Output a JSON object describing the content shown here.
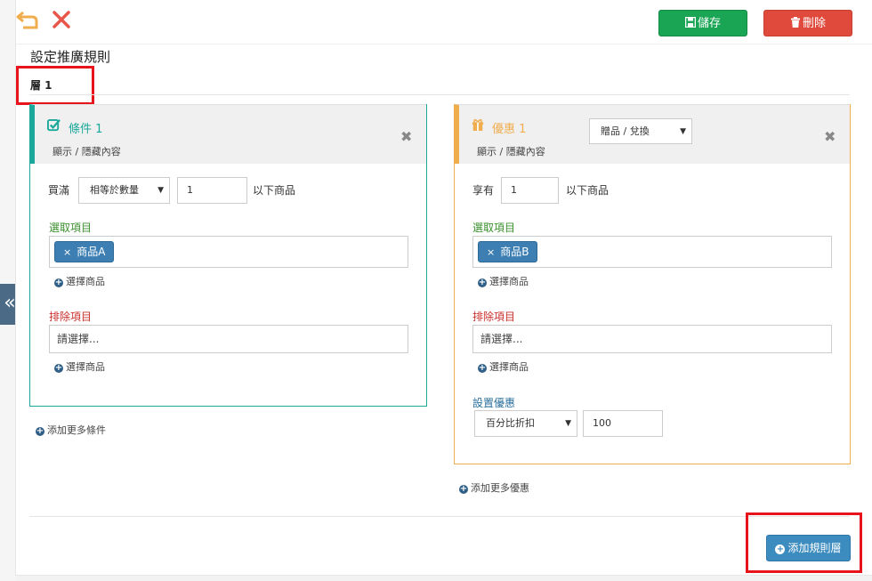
{
  "toolbar": {
    "save_label": "儲存",
    "delete_label": "刪除"
  },
  "page": {
    "title": "設定推廣規則",
    "layer_tab": "層 1"
  },
  "condition_card": {
    "title": "條件 1",
    "toggle_label": "顯示 / 隱藏內容",
    "buy_label": "買滿",
    "qty_mode": "相等於數量",
    "qty_value": "1",
    "suffix": "以下商品",
    "select_label": "選取項目",
    "selected_tag": "商品A",
    "select_product_link": "選擇商品",
    "exclude_label": "排除項目",
    "exclude_placeholder": "請選擇...",
    "exclude_product_link": "選擇商品"
  },
  "add_condition_link": "添加更多條件",
  "offer_card": {
    "title": "優惠 1",
    "type_select": "贈品 / 兌換",
    "toggle_label": "顯示 / 隱藏內容",
    "enjoy_label": "享有",
    "qty_value": "1",
    "suffix": "以下商品",
    "select_label": "選取項目",
    "selected_tag": "商品B",
    "select_product_link": "選擇商品",
    "exclude_label": "排除項目",
    "exclude_placeholder": "請選擇...",
    "exclude_product_link": "選擇商品",
    "discount_label": "設置優惠",
    "discount_type": "百分比折扣",
    "discount_value": "100"
  },
  "add_offer_link": "添加更多優惠",
  "add_layer_button": "添加規則層",
  "colors": {
    "save": "#1aa554",
    "delete": "#e04a3c",
    "condition_accent": "#1aa89a",
    "offer_accent": "#f0ad4e",
    "tag": "#3e7fb3",
    "highlight": "#e8141b"
  },
  "icons": {
    "undo": "undo-icon",
    "close": "close-icon",
    "save": "floppy-icon",
    "delete": "trash-icon",
    "condition": "checkbox-icon",
    "offer": "gift-icon",
    "remove_card": "remove-icon",
    "plus": "plus-circle-icon",
    "collapse": "double-chevron-left-icon"
  }
}
